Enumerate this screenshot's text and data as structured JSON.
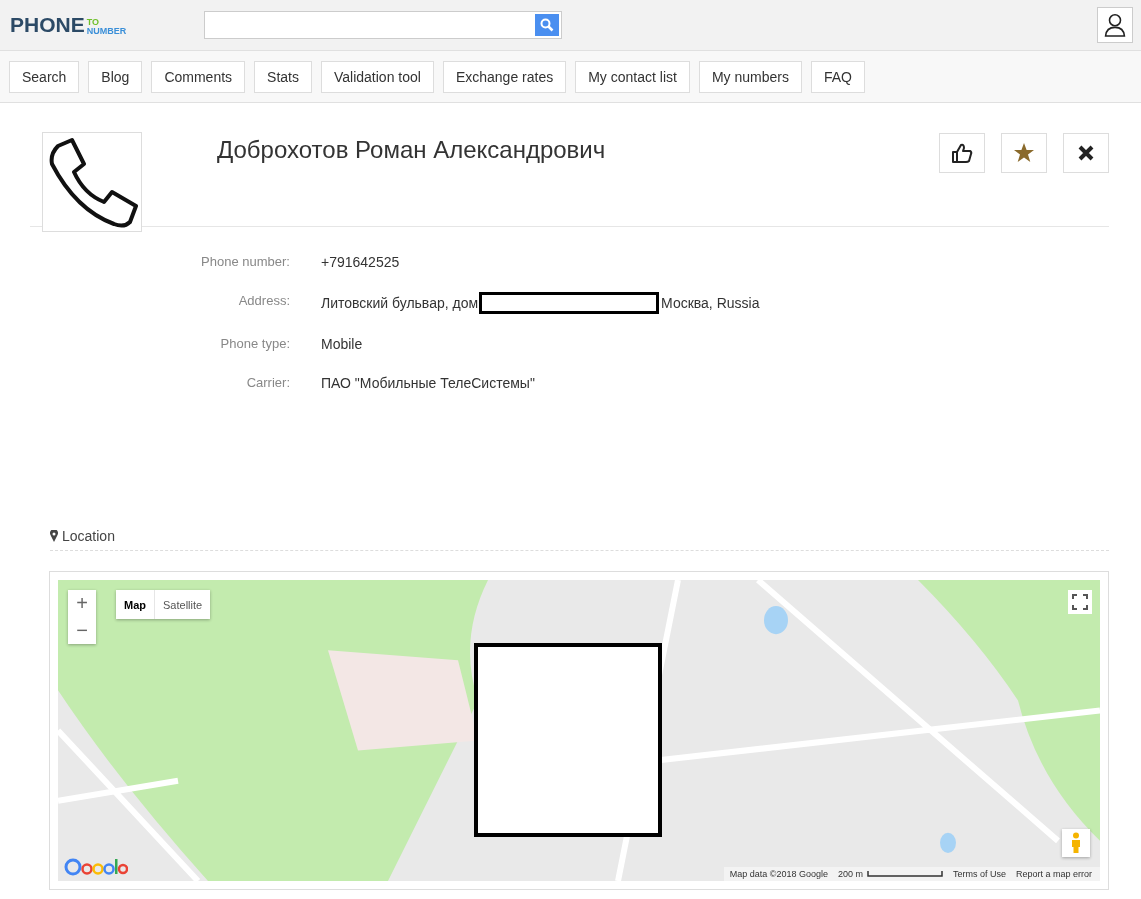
{
  "header": {
    "logo": {
      "main": "PHONE",
      "small_top": "TO",
      "small_bottom": "NUMBER"
    }
  },
  "nav": [
    "Search",
    "Blog",
    "Comments",
    "Stats",
    "Validation tool",
    "Exchange rates",
    "My contact list",
    "My numbers",
    "FAQ"
  ],
  "profile": {
    "name": "Доброхотов Роман Александрович"
  },
  "details": [
    {
      "label": "Phone number:",
      "value": "+791642525",
      "kind": "plain"
    },
    {
      "label": "Address:",
      "value": "Литовский бульвар, дом",
      "value_after": "Москва, Russia",
      "kind": "redacted"
    },
    {
      "label": "Phone type:",
      "value": "Mobile",
      "kind": "plain"
    },
    {
      "label": "Carrier:",
      "value": "ПАО \"Мобильные ТелеСистемы\"",
      "kind": "plain"
    }
  ],
  "location": {
    "title": "Location",
    "map": {
      "zoom_in": "+",
      "zoom_out": "−",
      "types": [
        {
          "label": "Map",
          "selected": true
        },
        {
          "label": "Satellite",
          "selected": false
        }
      ],
      "attribution": "Map data ©2018 Google",
      "scale": "200 m",
      "terms": "Terms of Use",
      "report": "Report a map error"
    }
  }
}
